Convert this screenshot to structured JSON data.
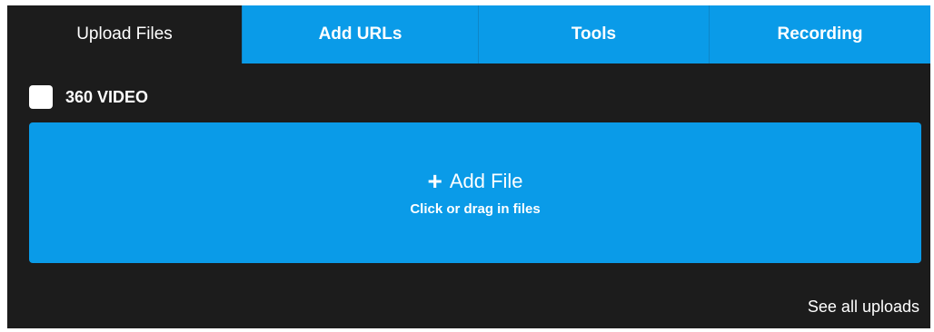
{
  "tabs": [
    {
      "label": "Upload Files",
      "active": true
    },
    {
      "label": "Add URLs",
      "active": false
    },
    {
      "label": "Tools",
      "active": false
    },
    {
      "label": "Recording",
      "active": false
    }
  ],
  "options": {
    "video360_label": "360 VIDEO",
    "video360_checked": false
  },
  "dropzone": {
    "icon": "plus-icon",
    "title": "Add File",
    "hint": "Click or drag in files"
  },
  "footer": {
    "see_all_label": "See all uploads"
  },
  "colors": {
    "accent": "#0a9be8",
    "background": "#1c1c1c",
    "text": "#ffffff"
  }
}
